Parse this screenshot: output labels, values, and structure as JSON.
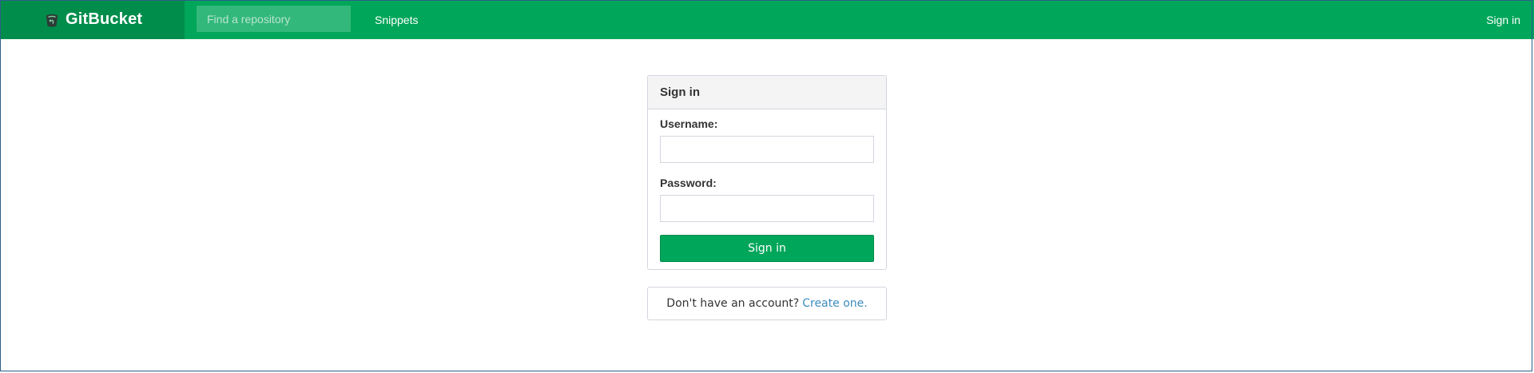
{
  "header": {
    "brand": "GitBucket",
    "logo_icon": "gitbucket-logo-icon",
    "search_placeholder": "Find a repository",
    "nav_snippets": "Snippets",
    "nav_signin": "Sign in",
    "colors": {
      "bar": "#00a65a",
      "brand_bg": "#008d4c"
    }
  },
  "signin_box": {
    "title": "Sign in",
    "username_label": "Username:",
    "username_value": "",
    "password_label": "Password:",
    "password_value": "",
    "submit_label": "Sign in"
  },
  "signup": {
    "prompt": "Don't have an account?",
    "link": "Create one."
  }
}
